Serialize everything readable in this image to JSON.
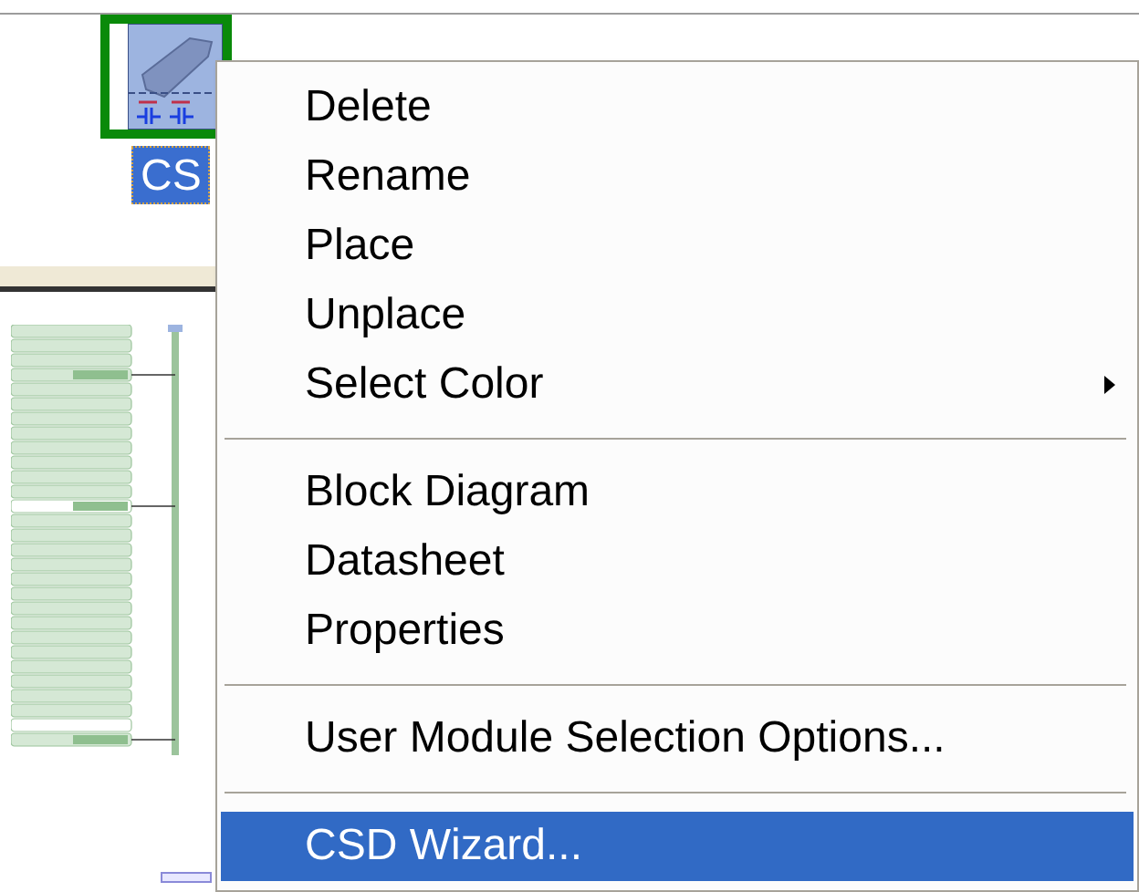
{
  "canvas": {
    "module": {
      "label": "CS",
      "selected": true
    }
  },
  "context_menu": {
    "items": [
      {
        "kind": "item",
        "label": "Delete",
        "selected": false
      },
      {
        "kind": "item",
        "label": "Rename",
        "selected": false
      },
      {
        "kind": "item",
        "label": "Place",
        "selected": false
      },
      {
        "kind": "item",
        "label": "Unplace",
        "selected": false
      },
      {
        "kind": "item",
        "label": "Select Color",
        "selected": false,
        "submenu": true
      },
      {
        "kind": "separator"
      },
      {
        "kind": "item",
        "label": "Block Diagram",
        "selected": false
      },
      {
        "kind": "item",
        "label": "Datasheet",
        "selected": false
      },
      {
        "kind": "item",
        "label": "Properties",
        "selected": false
      },
      {
        "kind": "separator"
      },
      {
        "kind": "item",
        "label": "User Module Selection Options...",
        "selected": false
      },
      {
        "kind": "separator"
      },
      {
        "kind": "item",
        "label": "CSD Wizard...",
        "selected": true
      }
    ]
  }
}
